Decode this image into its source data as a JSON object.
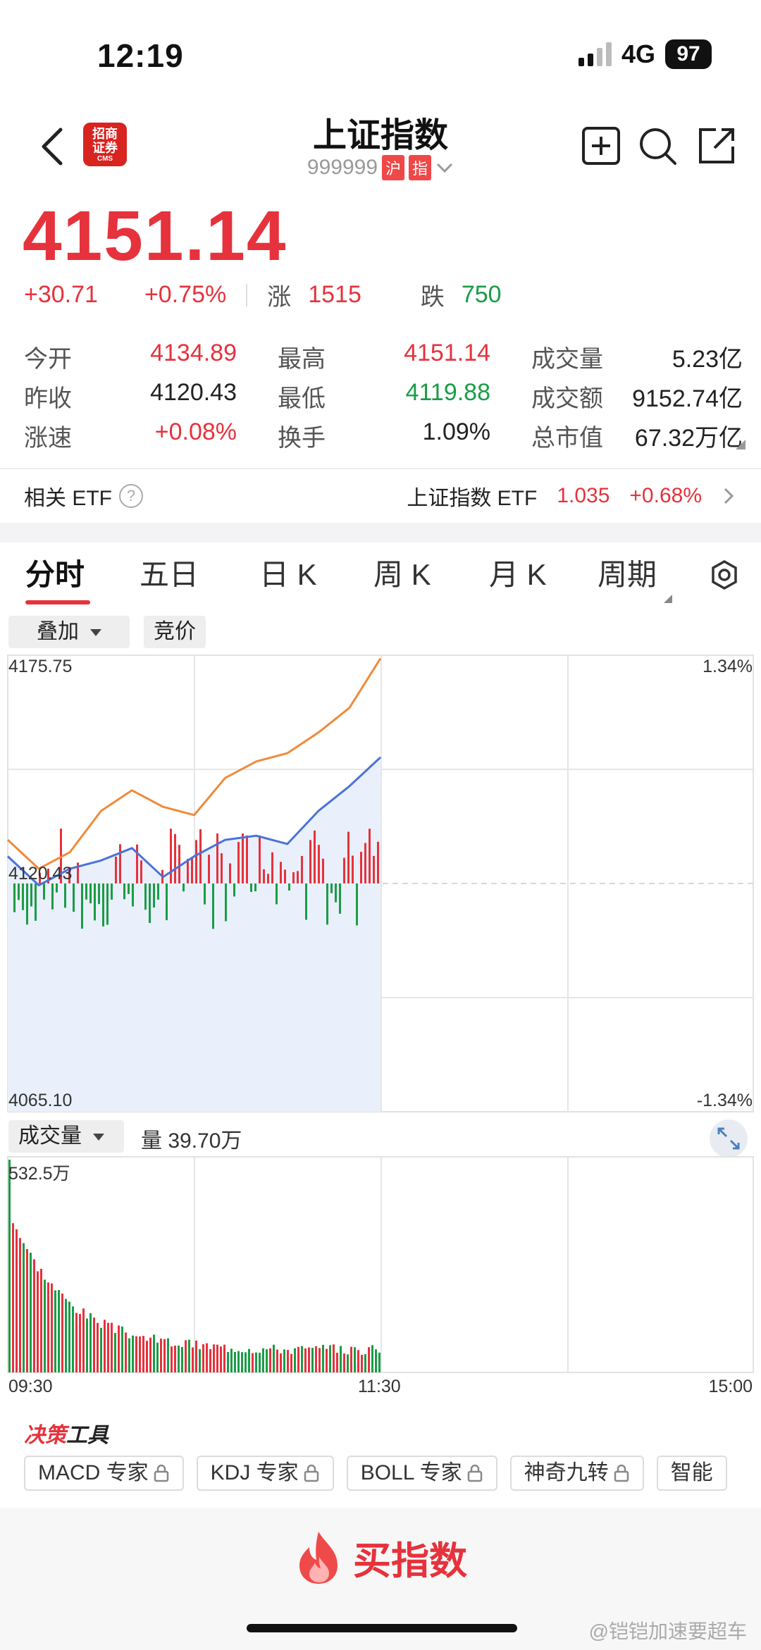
{
  "status_bar": {
    "time": "12:19",
    "network": "4G",
    "battery": "97"
  },
  "header": {
    "title": "上证指数",
    "code": "999999",
    "tag1": "沪",
    "tag2": "指",
    "logo_text_line1": "招商",
    "logo_text_line2": "证券",
    "logo_text_line3": "CMS"
  },
  "quote": {
    "price": "4151.14",
    "change": "+30.71",
    "change_pct": "+0.75%",
    "up_label": "涨",
    "up_count": "1515",
    "down_label": "跌",
    "down_count": "750"
  },
  "stats": [
    [
      {
        "label": "今开",
        "value": "4134.89",
        "color": "red"
      },
      {
        "label": "最高",
        "value": "4151.14",
        "color": "red"
      },
      {
        "label": "成交量",
        "value": "5.23亿",
        "color": "black"
      }
    ],
    [
      {
        "label": "昨收",
        "value": "4120.43",
        "color": "black"
      },
      {
        "label": "最低",
        "value": "4119.88",
        "color": "green"
      },
      {
        "label": "成交额",
        "value": "9152.74亿",
        "color": "black"
      }
    ],
    [
      {
        "label": "涨速",
        "value": "+0.08%",
        "color": "red"
      },
      {
        "label": "换手",
        "value": "1.09%",
        "color": "black"
      },
      {
        "label": "总市值",
        "value": "67.32万亿",
        "color": "black"
      }
    ]
  ],
  "etf": {
    "label": "相关 ETF",
    "help": "?",
    "name": "上证指数 ETF",
    "price": "1.035",
    "change_pct": "+0.68%"
  },
  "tabs": [
    "分时",
    "五日",
    "日 K",
    "周 K",
    "月 K",
    "周期"
  ],
  "chart_controls": {
    "overlay": "叠加",
    "auction": "竞价"
  },
  "price_chart": {
    "y_max_label": "4175.75",
    "y_mid_label": "4120.43",
    "y_min_label": "4065.10",
    "pct_max_label": "1.34%",
    "pct_min_label": "-1.34%"
  },
  "volume_panel": {
    "indicator": "成交量",
    "volume_text": "量 39.70万",
    "max_label": "532.5万",
    "time_start": "09:30",
    "time_mid": "11:30",
    "time_end": "15:00"
  },
  "chart_data": {
    "type": "line",
    "x": [
      "09:30",
      "09:40",
      "09:50",
      "10:00",
      "10:10",
      "10:20",
      "10:30",
      "10:40",
      "10:50",
      "11:00",
      "11:10",
      "11:20",
      "11:30"
    ],
    "series": [
      {
        "values": [
          4131,
          4124,
          4128,
          4138,
          4143,
          4139,
          4137,
          4146,
          4150,
          4152,
          4157,
          4163,
          4175
        ],
        "color": "#f08a3a"
      },
      {
        "values": [
          4127,
          4120,
          4124,
          4126,
          4129,
          4122,
          4127,
          4131,
          4132,
          4130,
          4138,
          4144,
          4151
        ],
        "color": "#4a72d9"
      }
    ],
    "ylim": [
      4065.1,
      4175.75
    ],
    "prev_close": 4120.43,
    "x_range": [
      "09:30",
      "15:00"
    ]
  },
  "tools": {
    "title_red": "决策",
    "title_black": "工具",
    "items": [
      "MACD 专家",
      "KDJ 专家",
      "BOLL 专家",
      "神奇九转",
      "智能"
    ]
  },
  "buy": {
    "label": "买指数"
  },
  "watermark": "@铠铠加速要超车",
  "colors": {
    "up": "#e6323c",
    "down": "#1a9c46",
    "line_orange": "#f08a3a",
    "line_blue": "#4a72d9"
  }
}
